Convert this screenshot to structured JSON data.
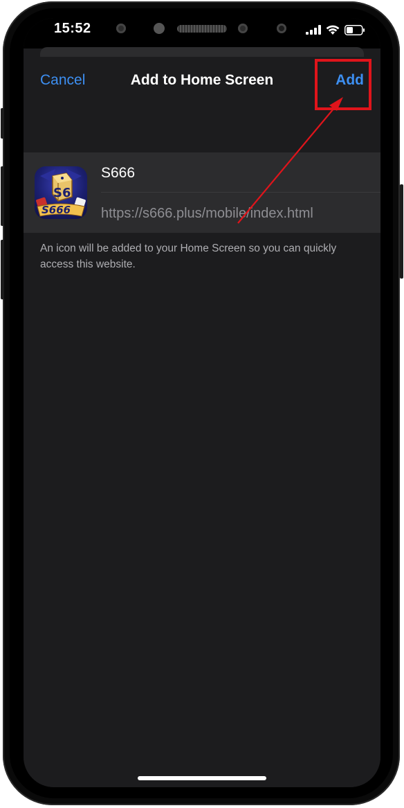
{
  "status_bar": {
    "time": "15:52"
  },
  "sheet": {
    "cancel_label": "Cancel",
    "title": "Add to Home Screen",
    "add_label": "Add"
  },
  "bookmark": {
    "name": "S666",
    "url": "https://s666.plus/mobile/index.html",
    "icon_text": "S666",
    "icon_dice_text": "S6"
  },
  "hint_text": "An icon will be added to your Home Screen so you can quickly access this website.",
  "colors": {
    "accent": "#3d8ff2",
    "annotation": "#e0141b",
    "sheet_bg": "#1c1c1e",
    "card_bg": "#2c2c2e"
  }
}
